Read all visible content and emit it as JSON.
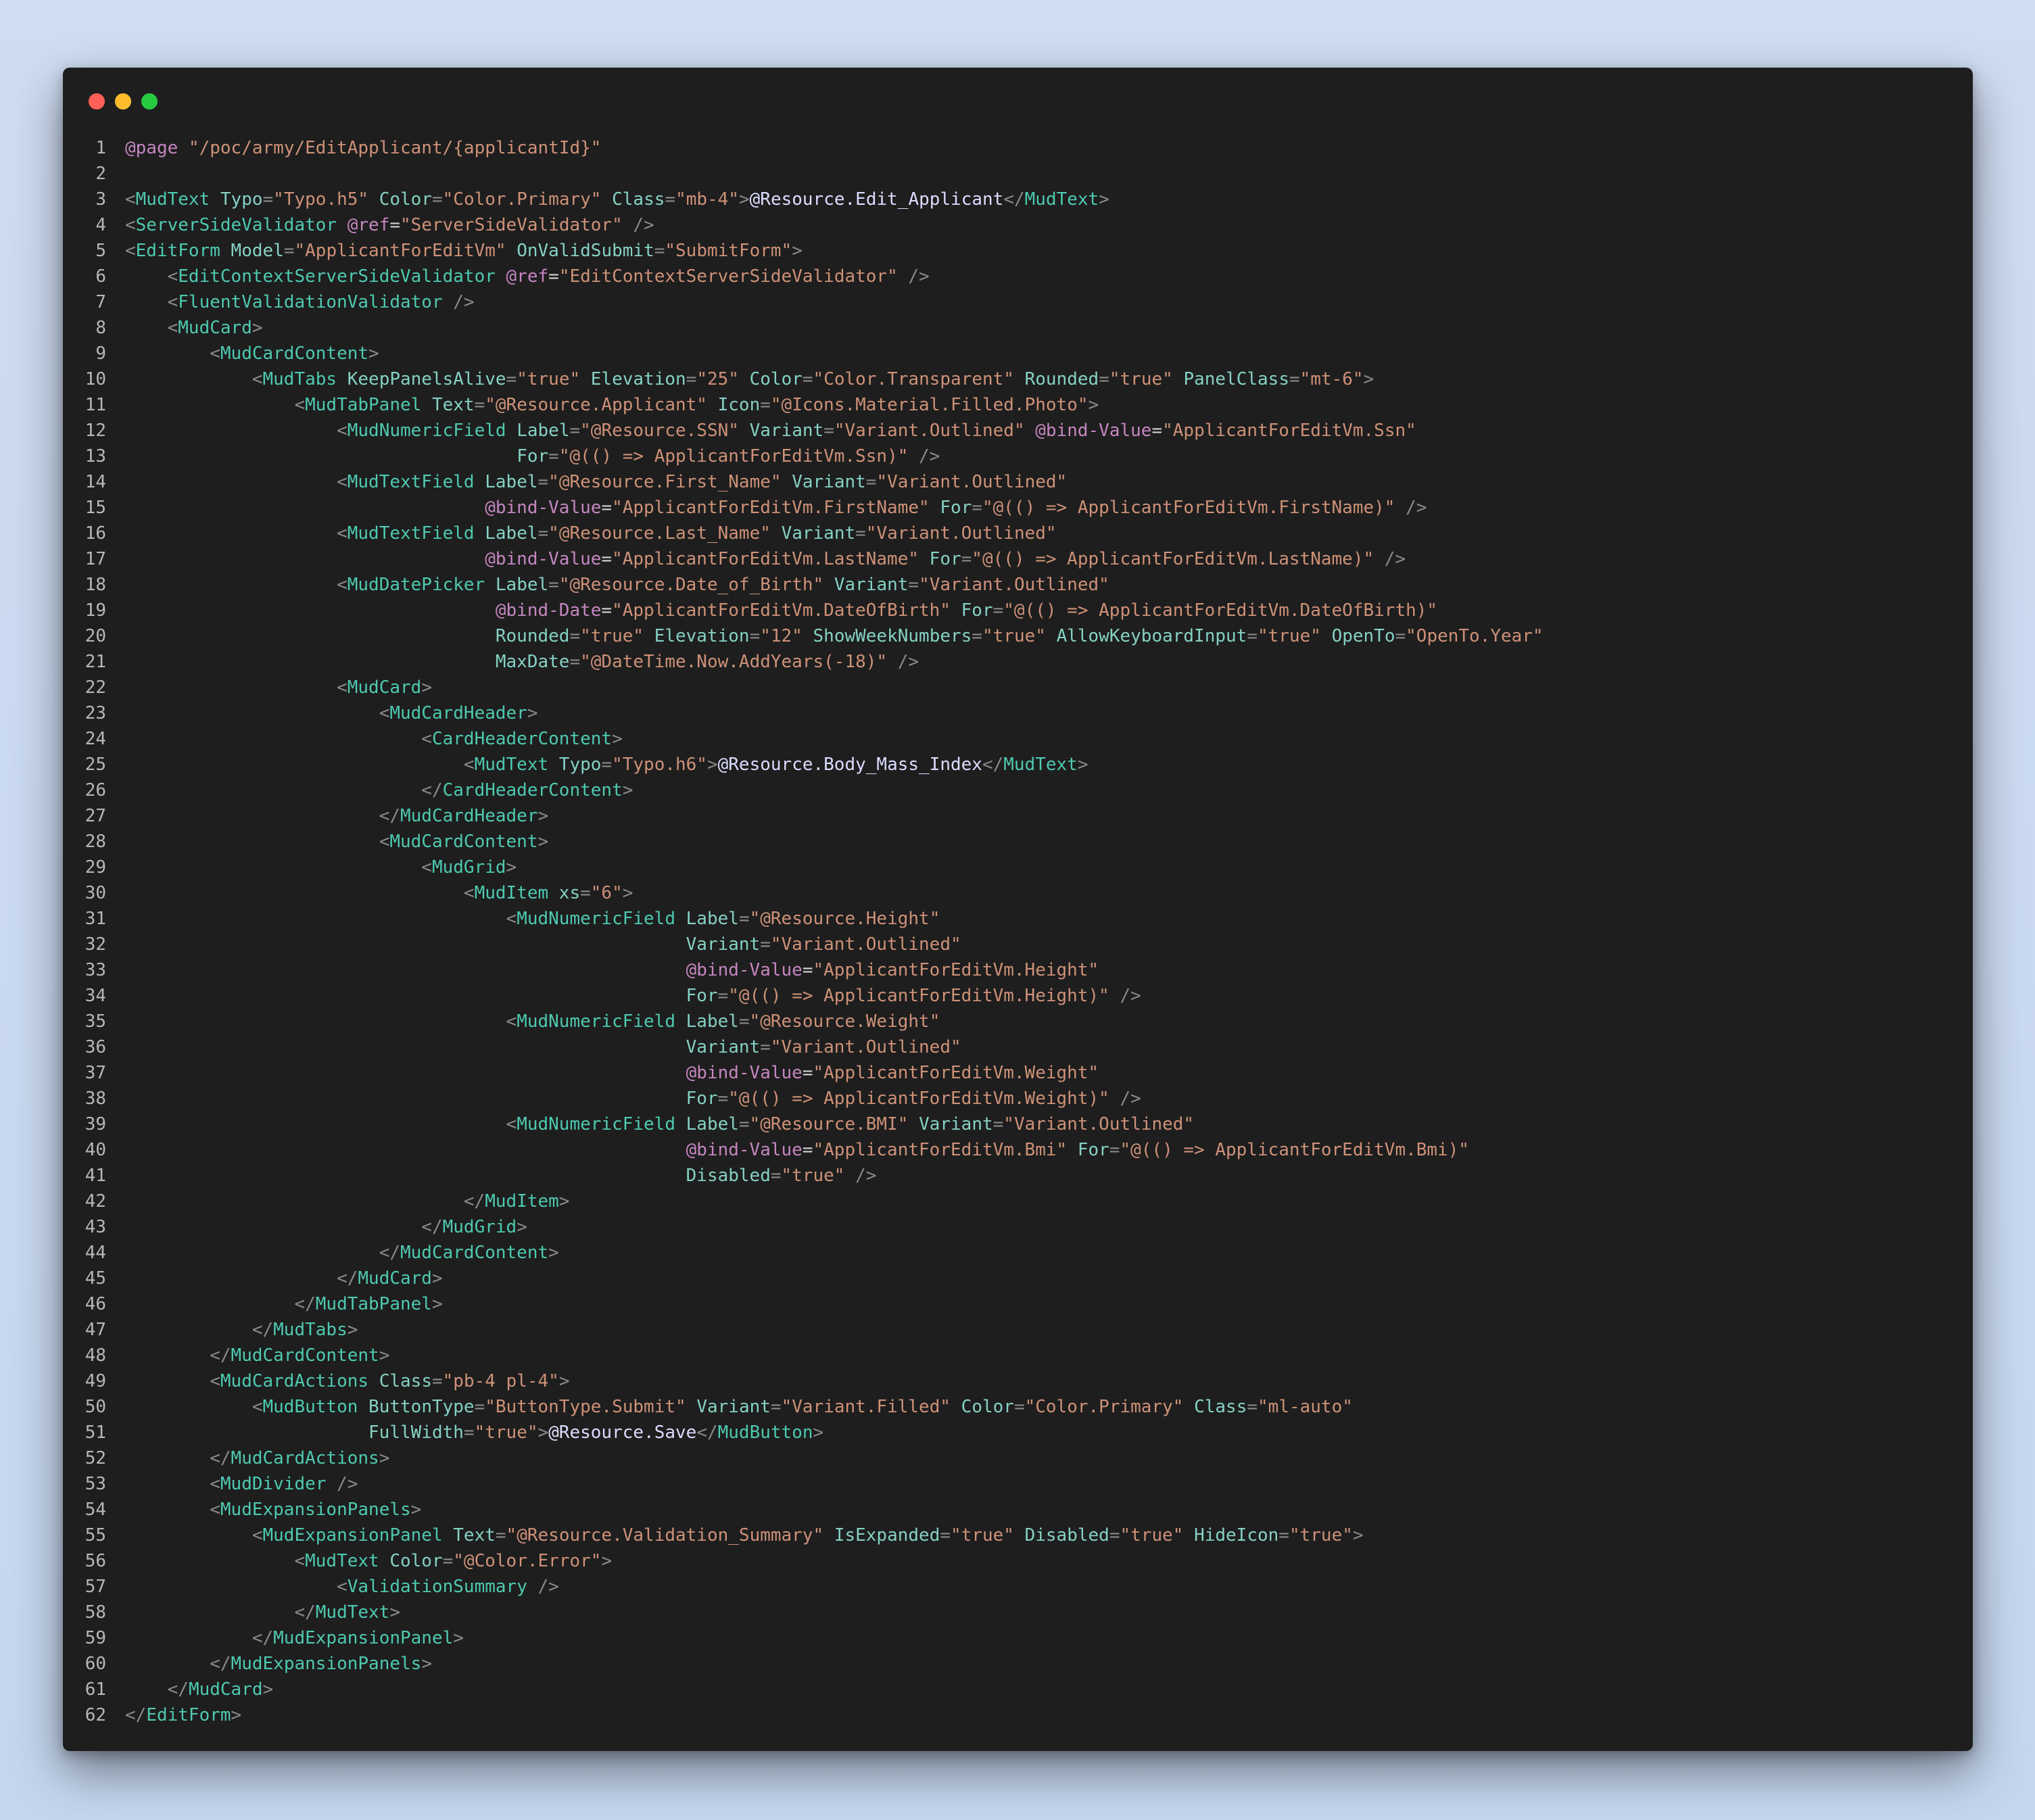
{
  "window": {
    "controls": [
      "close",
      "minimize",
      "maximize"
    ]
  },
  "colors": {
    "background": "#c7d8ee",
    "editor_bg": "#1e1e1e",
    "line_number": "#b7b7b7",
    "tag": "#4ec9b0",
    "string": "#ce9178",
    "razor": "#c586c0"
  },
  "code_lines": [
    "@page \"/poc/army/EditApplicant/{applicantId}\"",
    "",
    "<MudText Typo=\"Typo.h5\" Color=\"Color.Primary\" Class=\"mb-4\">@Resource.Edit_Applicant</MudText>",
    "<ServerSideValidator @ref=\"ServerSideValidator\" />",
    "<EditForm Model=\"ApplicantForEditVm\" OnValidSubmit=\"SubmitForm\">",
    "    <EditContextServerSideValidator @ref=\"EditContextServerSideValidator\" />",
    "    <FluentValidationValidator />",
    "    <MudCard>",
    "        <MudCardContent>",
    "            <MudTabs KeepPanelsAlive=\"true\" Elevation=\"25\" Color=\"Color.Transparent\" Rounded=\"true\" PanelClass=\"mt-6\">",
    "                <MudTabPanel Text=\"@Resource.Applicant\" Icon=\"@Icons.Material.Filled.Photo\">",
    "                    <MudNumericField Label=\"@Resource.SSN\" Variant=\"Variant.Outlined\" @bind-Value=\"ApplicantForEditVm.Ssn\"",
    "                                     For=\"@(() => ApplicantForEditVm.Ssn)\" />",
    "                    <MudTextField Label=\"@Resource.First_Name\" Variant=\"Variant.Outlined\"",
    "                                  @bind-Value=\"ApplicantForEditVm.FirstName\" For=\"@(() => ApplicantForEditVm.FirstName)\" />",
    "                    <MudTextField Label=\"@Resource.Last_Name\" Variant=\"Variant.Outlined\"",
    "                                  @bind-Value=\"ApplicantForEditVm.LastName\" For=\"@(() => ApplicantForEditVm.LastName)\" />",
    "                    <MudDatePicker Label=\"@Resource.Date_of_Birth\" Variant=\"Variant.Outlined\"",
    "                                   @bind-Date=\"ApplicantForEditVm.DateOfBirth\" For=\"@(() => ApplicantForEditVm.DateOfBirth)\"",
    "                                   Rounded=\"true\" Elevation=\"12\" ShowWeekNumbers=\"true\" AllowKeyboardInput=\"true\" OpenTo=\"OpenTo.Year\"",
    "                                   MaxDate=\"@DateTime.Now.AddYears(-18)\" />",
    "                    <MudCard>",
    "                        <MudCardHeader>",
    "                            <CardHeaderContent>",
    "                                <MudText Typo=\"Typo.h6\">@Resource.Body_Mass_Index</MudText>",
    "                            </CardHeaderContent>",
    "                        </MudCardHeader>",
    "                        <MudCardContent>",
    "                            <MudGrid>",
    "                                <MudItem xs=\"6\">",
    "                                    <MudNumericField Label=\"@Resource.Height\"",
    "                                                     Variant=\"Variant.Outlined\"",
    "                                                     @bind-Value=\"ApplicantForEditVm.Height\"",
    "                                                     For=\"@(() => ApplicantForEditVm.Height)\" />",
    "                                    <MudNumericField Label=\"@Resource.Weight\"",
    "                                                     Variant=\"Variant.Outlined\"",
    "                                                     @bind-Value=\"ApplicantForEditVm.Weight\"",
    "                                                     For=\"@(() => ApplicantForEditVm.Weight)\" />",
    "                                    <MudNumericField Label=\"@Resource.BMI\" Variant=\"Variant.Outlined\"",
    "                                                     @bind-Value=\"ApplicantForEditVm.Bmi\" For=\"@(() => ApplicantForEditVm.Bmi)\"",
    "                                                     Disabled=\"true\" />",
    "                                </MudItem>",
    "                            </MudGrid>",
    "                        </MudCardContent>",
    "                    </MudCard>",
    "                </MudTabPanel>",
    "            </MudTabs>",
    "        </MudCardContent>",
    "        <MudCardActions Class=\"pb-4 pl-4\">",
    "            <MudButton ButtonType=\"ButtonType.Submit\" Variant=\"Variant.Filled\" Color=\"Color.Primary\" Class=\"ml-auto\"",
    "                       FullWidth=\"true\">@Resource.Save</MudButton>",
    "        </MudCardActions>",
    "        <MudDivider />",
    "        <MudExpansionPanels>",
    "            <MudExpansionPanel Text=\"@Resource.Validation_Summary\" IsExpanded=\"true\" Disabled=\"true\" HideIcon=\"true\">",
    "                <MudText Color=\"@Color.Error\">",
    "                    <ValidationSummary />",
    "                </MudText>",
    "            </MudExpansionPanel>",
    "        </MudExpansionPanels>",
    "    </MudCard>",
    "</EditForm>"
  ]
}
